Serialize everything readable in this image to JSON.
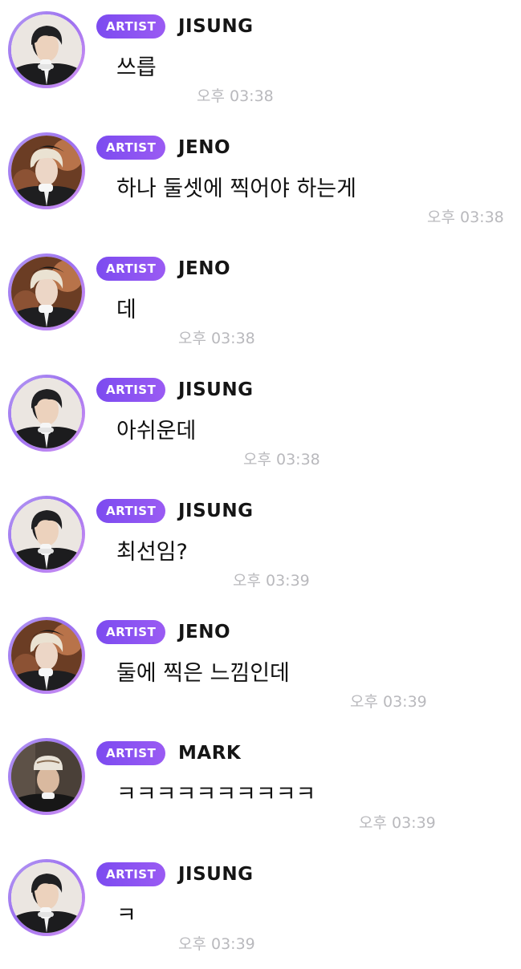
{
  "badge_label": "ARTIST",
  "messages": [
    {
      "sender": "JISUNG",
      "avatar": "jisung-avatar",
      "text": "쓰릅",
      "time": "오후 03:38"
    },
    {
      "sender": "JENO",
      "avatar": "jeno-avatar",
      "text": "하나 둘셋에 찍어야 하는게",
      "time": "오후 03:38"
    },
    {
      "sender": "JENO",
      "avatar": "jeno-avatar",
      "text": "데",
      "time": "오후 03:38"
    },
    {
      "sender": "JISUNG",
      "avatar": "jisung-avatar",
      "text": "아쉬운데",
      "time": "오후 03:38"
    },
    {
      "sender": "JISUNG",
      "avatar": "jisung-avatar",
      "text": "최선임?",
      "time": "오후 03:39"
    },
    {
      "sender": "JENO",
      "avatar": "jeno-avatar",
      "text": "둘에 찍은 느낌인데",
      "time": "오후 03:39"
    },
    {
      "sender": "MARK",
      "avatar": "mark-avatar",
      "text": "ㅋㅋㅋㅋㅋㅋㅋㅋㅋㅋ",
      "time": "오후 03:39"
    },
    {
      "sender": "JISUNG",
      "avatar": "jisung-avatar",
      "text": "ㅋ",
      "time": "오후 03:39"
    }
  ],
  "colors": {
    "badge": "#7c4bf0",
    "avatar_ring": "#a57cf2",
    "timestamp": "#b9b9bd"
  }
}
